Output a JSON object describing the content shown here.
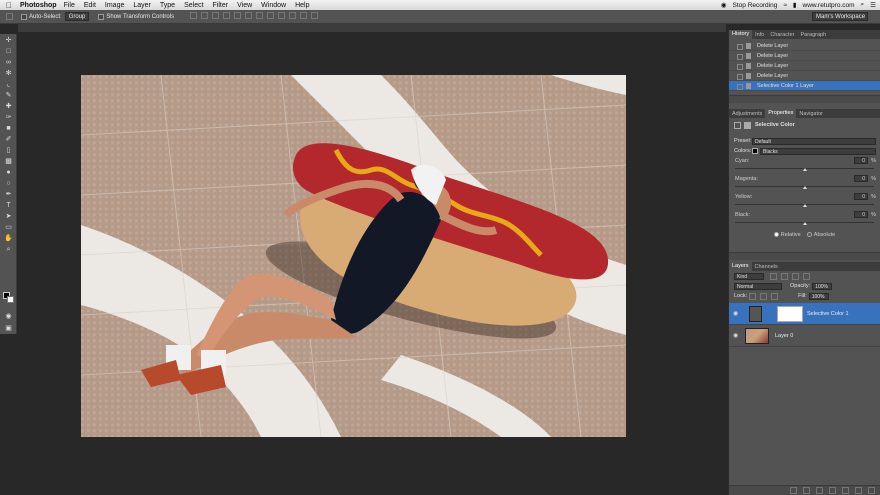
{
  "menubar": {
    "apple": "",
    "app_name": "Photoshop",
    "menus": [
      "File",
      "Edit",
      "Image",
      "Layer",
      "Type",
      "Select",
      "Filter",
      "View",
      "Window",
      "Help"
    ],
    "stop_recording": "Stop Recording",
    "website": "www.retutpro.com"
  },
  "options": {
    "auto_select_label": "Auto-Select:",
    "auto_select_value": "Group",
    "show_transform": "Show Transform Controls",
    "workspace": "Mam's Workspace"
  },
  "history": {
    "tabs": [
      "History",
      "Info",
      "Character",
      "Paragraph"
    ],
    "items": [
      {
        "label": "Delete Layer"
      },
      {
        "label": "Delete Layer"
      },
      {
        "label": "Delete Layer"
      },
      {
        "label": "Delete Layer"
      },
      {
        "label": "Selective Color 1 Layer"
      }
    ]
  },
  "properties": {
    "tabs": [
      "Adjustments",
      "Properties",
      "Navigator"
    ],
    "title": "Selective Color",
    "preset_label": "Preset:",
    "preset_value": "Default",
    "colors_label": "Colors:",
    "colors_value": "Blacks",
    "sliders": [
      {
        "name": "Cyan:",
        "value": "0",
        "pct": "%",
        "level": 0.5
      },
      {
        "name": "Magenta:",
        "value": "0",
        "pct": "%",
        "level": 0.5
      },
      {
        "name": "Yellow:",
        "value": "0",
        "pct": "%",
        "level": 0.5
      },
      {
        "name": "Black:",
        "value": "0",
        "pct": "%",
        "level": 0.5
      }
    ],
    "relative": "Relative",
    "absolute": "Absolute"
  },
  "layers": {
    "tabs": [
      "Layers",
      "Channels"
    ],
    "kind": "Kind",
    "blend_mode": "Normal",
    "opacity_label": "Opacity:",
    "opacity_value": "100%",
    "lock_label": "Lock:",
    "fill_label": "Fill:",
    "fill_value": "100%",
    "items": [
      {
        "name": "Selective Color 1"
      },
      {
        "name": "Layer 0"
      }
    ]
  },
  "colors": {
    "accent": "#3872bd",
    "hotdog": "#b3282c",
    "bun": "#d9ab74",
    "mustard": "#e8a817"
  }
}
